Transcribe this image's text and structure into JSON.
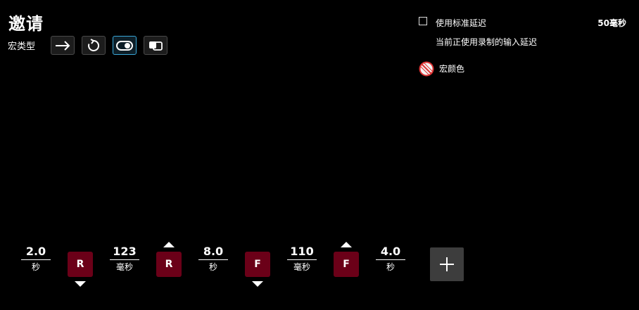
{
  "title": "邀请",
  "macro_type": {
    "label": "宏类型",
    "buttons": [
      {
        "icon": "arrow-right-icon",
        "active": false
      },
      {
        "icon": "repeat-icon",
        "active": false
      },
      {
        "icon": "toggle-icon",
        "active": true
      },
      {
        "icon": "sequence-icon",
        "active": false
      }
    ]
  },
  "delay_settings": {
    "checkbox_label": "使用标准延迟",
    "value": "50毫秒",
    "sub_label": "当前正使用录制的输入延迟",
    "checked": false
  },
  "macro_color": {
    "label": "宏颜色",
    "icon": "no-color-icon"
  },
  "sequence": [
    {
      "kind": "delay",
      "value": "2.0",
      "unit": "秒"
    },
    {
      "kind": "key",
      "label": "R",
      "direction": "down"
    },
    {
      "kind": "delay",
      "value": "123",
      "unit": "毫秒"
    },
    {
      "kind": "key",
      "label": "R",
      "direction": "up"
    },
    {
      "kind": "delay",
      "value": "8.0",
      "unit": "秒"
    },
    {
      "kind": "key",
      "label": "F",
      "direction": "down"
    },
    {
      "kind": "delay",
      "value": "110",
      "unit": "毫秒"
    },
    {
      "kind": "key",
      "label": "F",
      "direction": "up"
    },
    {
      "kind": "delay",
      "value": "4.0",
      "unit": "秒"
    }
  ],
  "add_button_icon": "plus-icon",
  "colors": {
    "key_bg": "#6b0018",
    "active_border": "#3aa7d9",
    "add_bg": "#3d3d3d"
  }
}
